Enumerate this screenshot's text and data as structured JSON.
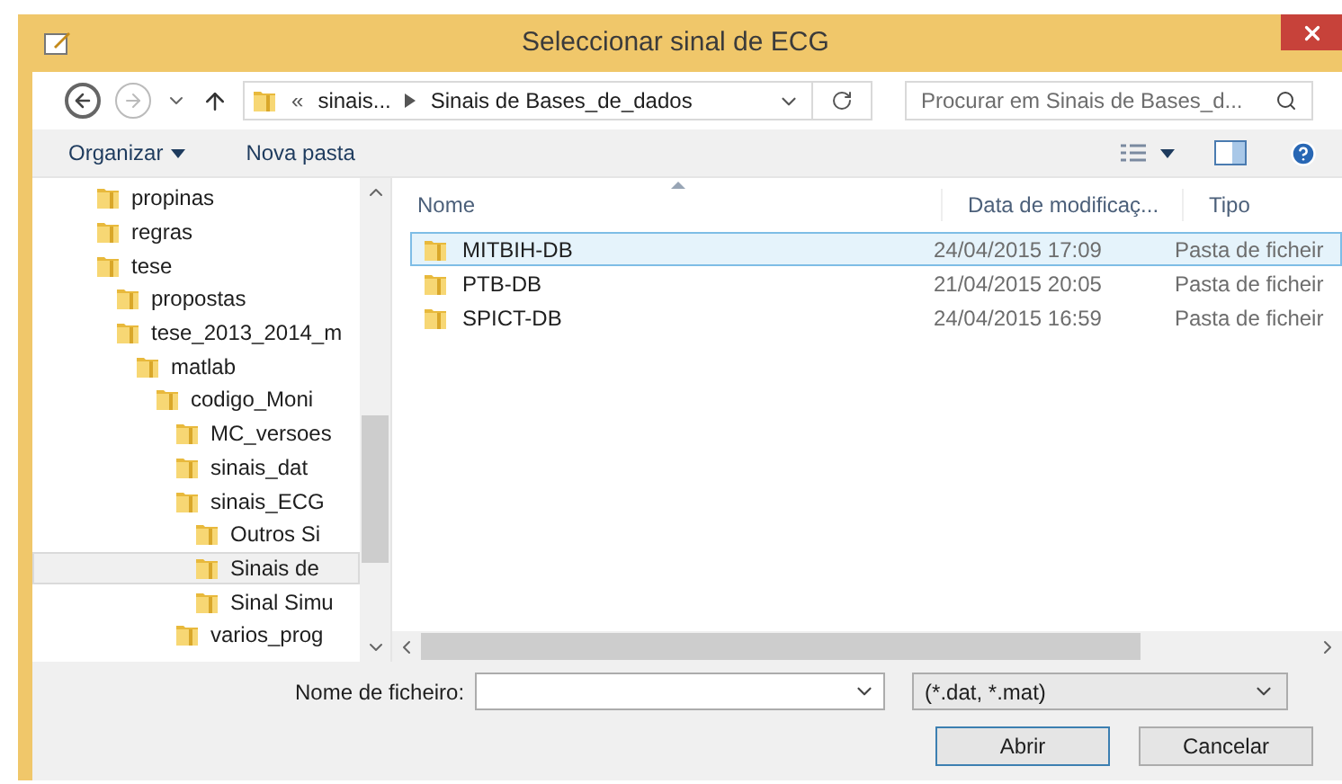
{
  "window": {
    "title": "Seleccionar sinal de ECG"
  },
  "address": {
    "overflow": "«",
    "crumbs": [
      "sinais...",
      "Sinais de Bases_de_dados"
    ]
  },
  "search": {
    "placeholder": "Procurar em Sinais de Bases_d..."
  },
  "toolbar": {
    "organize": "Organizar",
    "new_folder": "Nova pasta"
  },
  "tree": [
    {
      "label": "propinas",
      "selected": false
    },
    {
      "label": "regras",
      "selected": false
    },
    {
      "label": "tese",
      "selected": false,
      "children": [
        {
          "label": "propostas",
          "selected": false
        },
        {
          "label": "tese_2013_2014_m",
          "selected": false,
          "children": [
            {
              "label": "matlab",
              "selected": false,
              "children": [
                {
                  "label": "codigo_Moni",
                  "selected": false,
                  "children": [
                    {
                      "label": "MC_versoes",
                      "selected": false
                    },
                    {
                      "label": "sinais_dat",
                      "selected": false
                    },
                    {
                      "label": "sinais_ECG",
                      "selected": false,
                      "children": [
                        {
                          "label": "Outros Si",
                          "selected": false
                        },
                        {
                          "label": "Sinais de",
                          "selected": true
                        },
                        {
                          "label": "Sinal Simu",
                          "selected": false
                        }
                      ]
                    },
                    {
                      "label": "varios_prog",
                      "selected": false
                    }
                  ]
                }
              ]
            }
          ]
        }
      ]
    }
  ],
  "columns": [
    "Nome",
    "Data de modificaç...",
    "Tipo"
  ],
  "files": [
    {
      "name": "MITBIH-DB",
      "date": "24/04/2015 17:09",
      "type": "Pasta de ficheir",
      "selected": true
    },
    {
      "name": "PTB-DB",
      "date": "21/04/2015 20:05",
      "type": "Pasta de ficheir",
      "selected": false
    },
    {
      "name": "SPICT-DB",
      "date": "24/04/2015 16:59",
      "type": "Pasta de ficheir",
      "selected": false
    }
  ],
  "filename": {
    "label": "Nome de ficheiro:"
  },
  "filter": {
    "value": "(*.dat, *.mat)"
  },
  "buttons": [
    {
      "label": "Abrir",
      "default": true
    },
    {
      "label": "Cancelar",
      "default": false
    }
  ]
}
